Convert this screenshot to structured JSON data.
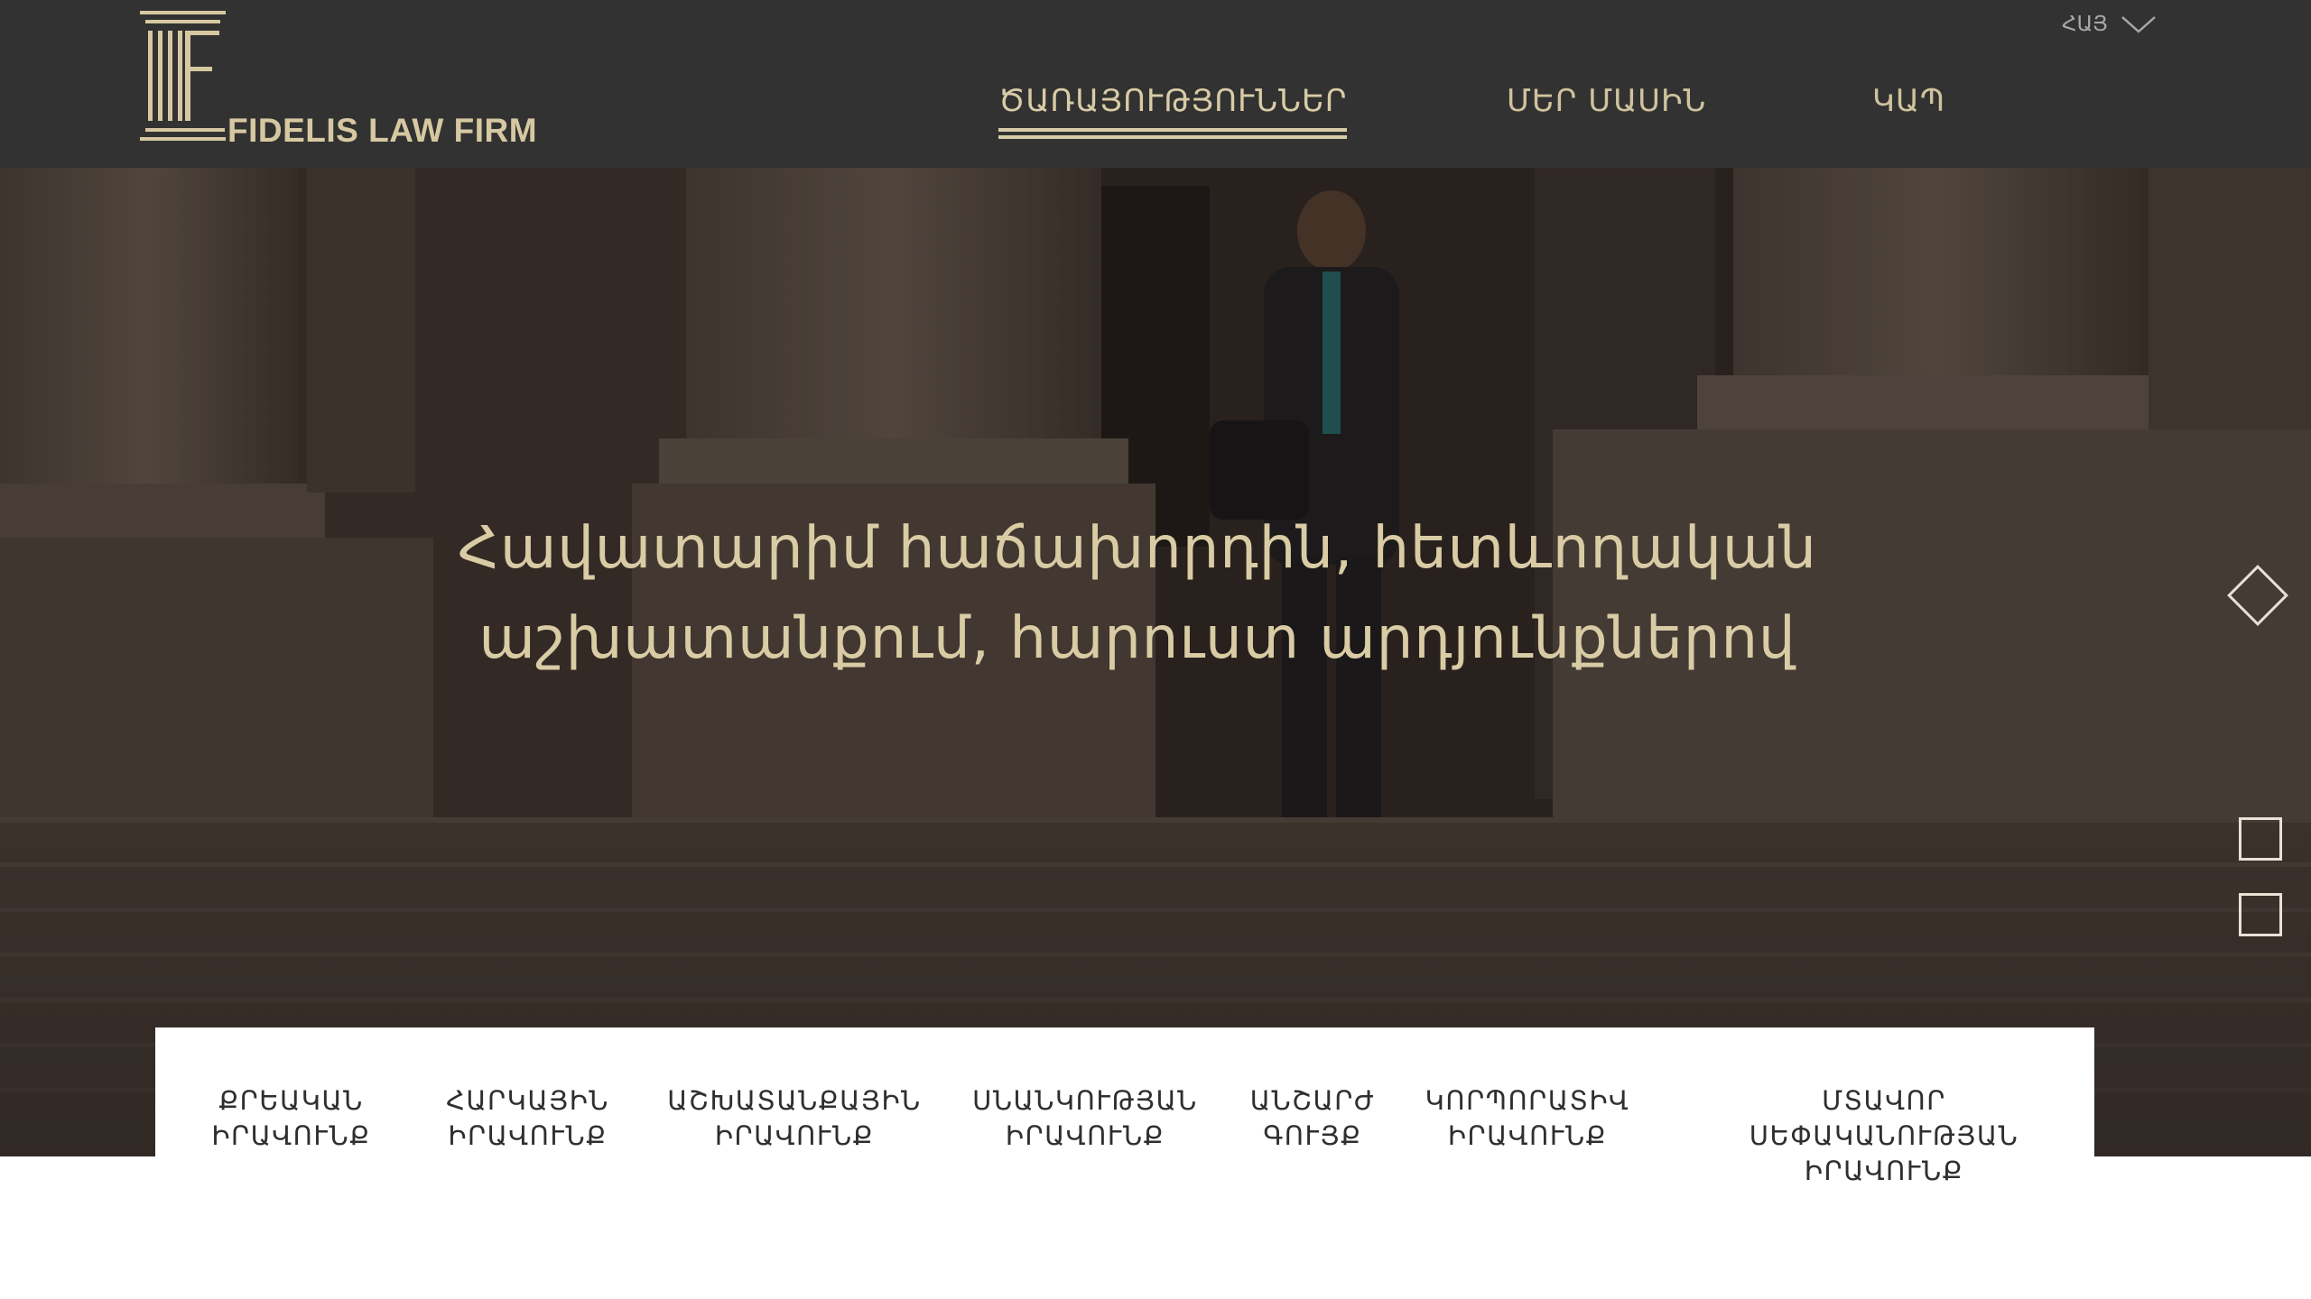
{
  "brand": {
    "name": "FIDELIS LAW FIRM",
    "gold": "#d6c9a2",
    "header_bg": "#333232"
  },
  "lang": {
    "selected": "ՀԱՅ",
    "icon": "chevron-down-icon"
  },
  "nav": {
    "items": [
      {
        "label": "ԾԱՌԱՅՈՒԹՅՈՒՆՆԵՐ",
        "active": true
      },
      {
        "label": "ՄԵՐ ՄԱՍԻՆ",
        "active": false
      },
      {
        "label": "ԿԱՊ",
        "active": false
      }
    ]
  },
  "hero": {
    "line1": "Հավատարիմ հաճախորդին, հետևողական",
    "line2": "աշխատանքում, հարուստ արդյունքներով"
  },
  "slider": {
    "count": 3,
    "active_index": 0
  },
  "areas": {
    "items": [
      {
        "line1": "ՔՐԵԱԿԱՆ",
        "line2": "ԻՐԱՎՈՒՆՔ",
        "line3": ""
      },
      {
        "line1": "ՀԱՐԿԱՅԻՆ",
        "line2": "ԻՐԱՎՈՒՆՔ",
        "line3": ""
      },
      {
        "line1": "ԱՇԽԱՏԱՆՔԱՅԻՆ",
        "line2": "ԻՐԱՎՈՒՆՔ",
        "line3": ""
      },
      {
        "line1": "ՍՆԱՆԿՈՒԹՅԱՆ",
        "line2": "ԻՐԱՎՈՒՆՔ",
        "line3": ""
      },
      {
        "line1": "ԱՆՇԱՐԺ",
        "line2": "ԳՈՒՅՔ",
        "line3": ""
      },
      {
        "line1": "ԿՈՐՊՈՐԱՏԻՎ",
        "line2": "ԻՐԱՎՈՒՆՔ",
        "line3": ""
      },
      {
        "line1": "ՄՏԱՎՈՐ",
        "line2": "ՍԵՓԱԿԱՆՈՒԹՅԱՆ",
        "line3": "ԻՐԱՎՈՒՆՔ"
      }
    ]
  }
}
